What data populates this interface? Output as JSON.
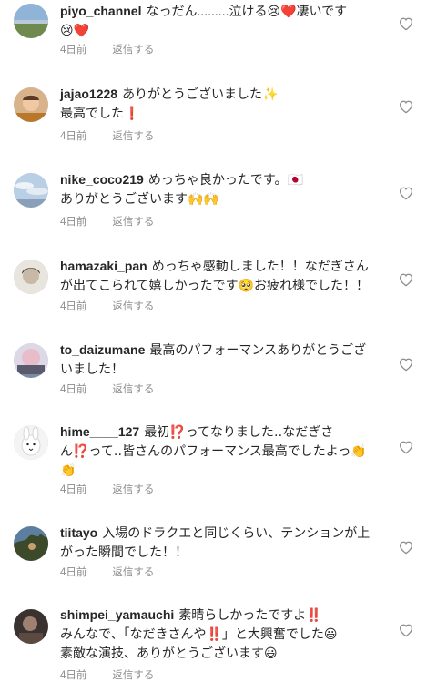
{
  "comments": [
    {
      "username": "piyo_channel",
      "lines": [
        "なっだん.........泣ける😢❤️凄いです",
        "😢❤️"
      ],
      "time": "4日前",
      "reply": "返信する",
      "like_icon": "heart-outline-icon"
    },
    {
      "username": "jajao1228",
      "lines": [
        "ありがとうございました✨",
        "最高でした❗"
      ],
      "time": "4日前",
      "reply": "返信する",
      "like_icon": "heart-outline-icon"
    },
    {
      "username": "nike_coco219",
      "lines": [
        "めっちゃ良かったです。🇯🇵",
        "ありがとうございます🙌🙌"
      ],
      "time": "4日前",
      "reply": "返信する",
      "like_icon": "heart-outline-icon"
    },
    {
      "username": "hamazaki_pan",
      "lines": [
        "めっちゃ感動しました！！なだぎさん",
        "が出てこられて嬉しかったです🥺お疲れ様でした！！"
      ],
      "time": "4日前",
      "reply": "返信する",
      "like_icon": "heart-outline-icon"
    },
    {
      "username": "to_daizumane",
      "lines": [
        "最高のパフォーマンスありがとうござ",
        "いました！"
      ],
      "time": "4日前",
      "reply": "返信する",
      "like_icon": "heart-outline-icon"
    },
    {
      "username": "hime____127",
      "lines": [
        "最初⁉️ってなりました‥なだぎさ",
        "ん⁉️って‥皆さんのパフォーマンス最高でしたよっ👏",
        "👏"
      ],
      "time": "4日前",
      "reply": "返信する",
      "like_icon": "heart-outline-icon"
    },
    {
      "username": "tiitayo",
      "lines": [
        "入場のドラクエと同じくらい、テンションが上",
        "がった瞬間でした！！"
      ],
      "time": "4日前",
      "reply": "返信する",
      "like_icon": "heart-outline-icon"
    },
    {
      "username": "shimpei_yamauchi",
      "lines": [
        "素晴らしかったですよ‼️",
        "みんなで、「なだきさんや‼️」と大興奮でした😃",
        "素敵な演技、ありがとうございます😃"
      ],
      "time": "4日前",
      "reply": "返信する",
      "like_icon": "heart-outline-icon"
    }
  ]
}
